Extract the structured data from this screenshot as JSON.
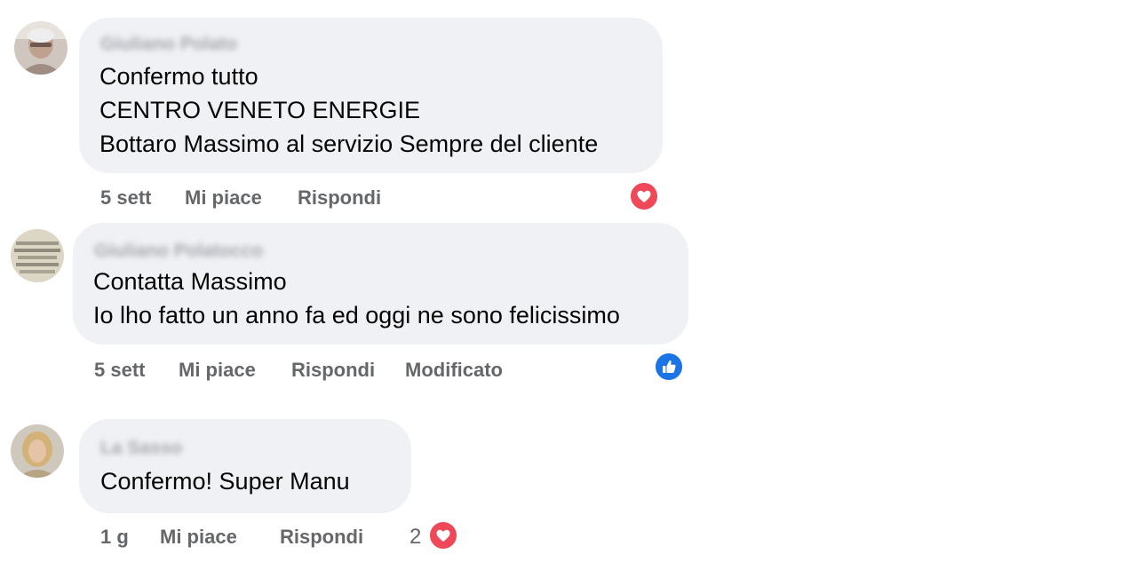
{
  "comments": [
    {
      "author": "Giuliano Polato",
      "lines": [
        "Confermo tutto",
        "CENTRO VENETO ENERGIE",
        "Bottaro Massimo al servizio Sempre del cliente"
      ],
      "time": "5 sett",
      "like_label": "Mi piace",
      "reply_label": "Rispondi",
      "reaction": "love-icon"
    },
    {
      "author": "Giuliano Polatocco",
      "lines": [
        "Contatta Massimo",
        "Io lho fatto un anno fa ed oggi ne sono felicissimo"
      ],
      "time": "5 sett",
      "like_label": "Mi piace",
      "reply_label": "Rispondi",
      "edited_label": "Modificato",
      "reaction": "like-icon"
    },
    {
      "author": "La Sasso",
      "lines": [
        "Confermo! Super Manu"
      ],
      "time": "1 g",
      "like_label": "Mi piace",
      "reply_label": "Rispondi",
      "reaction": "love-icon",
      "reaction_count": "2"
    }
  ],
  "colors": {
    "bubble": "#f0f1f4",
    "meta_text": "#65676b",
    "love": "#ef4858",
    "like": "#1b74e4"
  }
}
